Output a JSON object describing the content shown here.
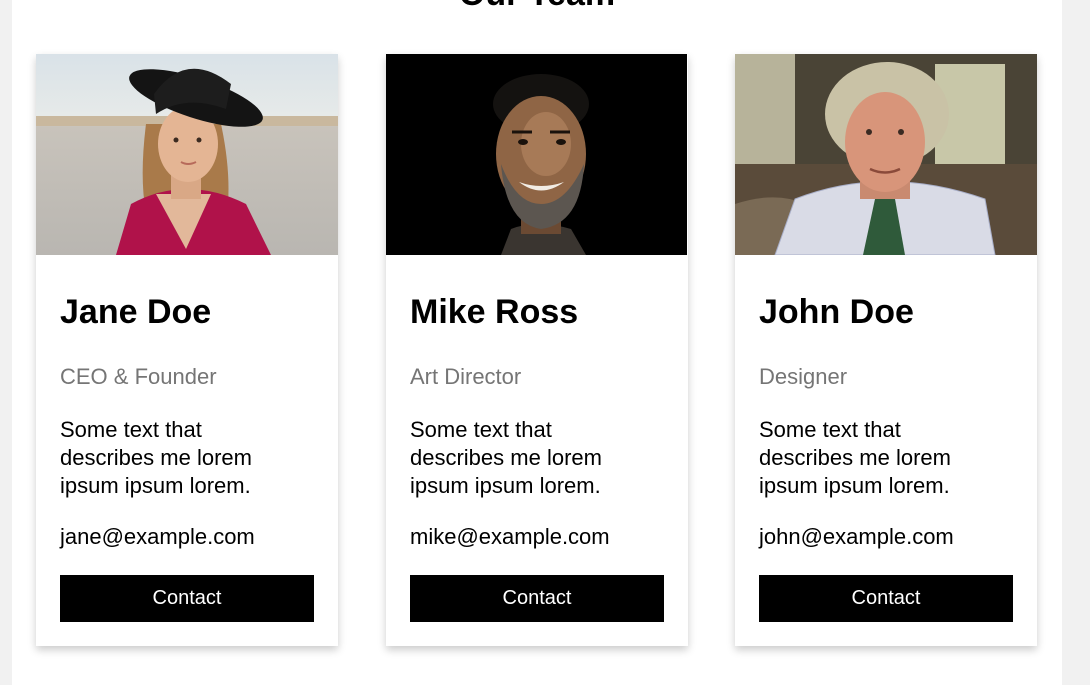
{
  "heading": "Our Team",
  "team": [
    {
      "name": "Jane Doe",
      "title": "CEO & Founder",
      "description": "Some text that describes me lorem ipsum ipsum lorem.",
      "email": "jane@example.com",
      "contact_label": "Contact"
    },
    {
      "name": "Mike Ross",
      "title": "Art Director",
      "description": "Some text that describes me lorem ipsum ipsum lorem.",
      "email": "mike@example.com",
      "contact_label": "Contact"
    },
    {
      "name": "John Doe",
      "title": "Designer",
      "description": "Some text that describes me lorem ipsum ipsum lorem.",
      "email": "john@example.com",
      "contact_label": "Contact"
    }
  ],
  "colors": {
    "button_bg": "#000000",
    "button_text": "#ffffff",
    "title_gray": "#757575",
    "page_bg": "#f1f1f1"
  }
}
